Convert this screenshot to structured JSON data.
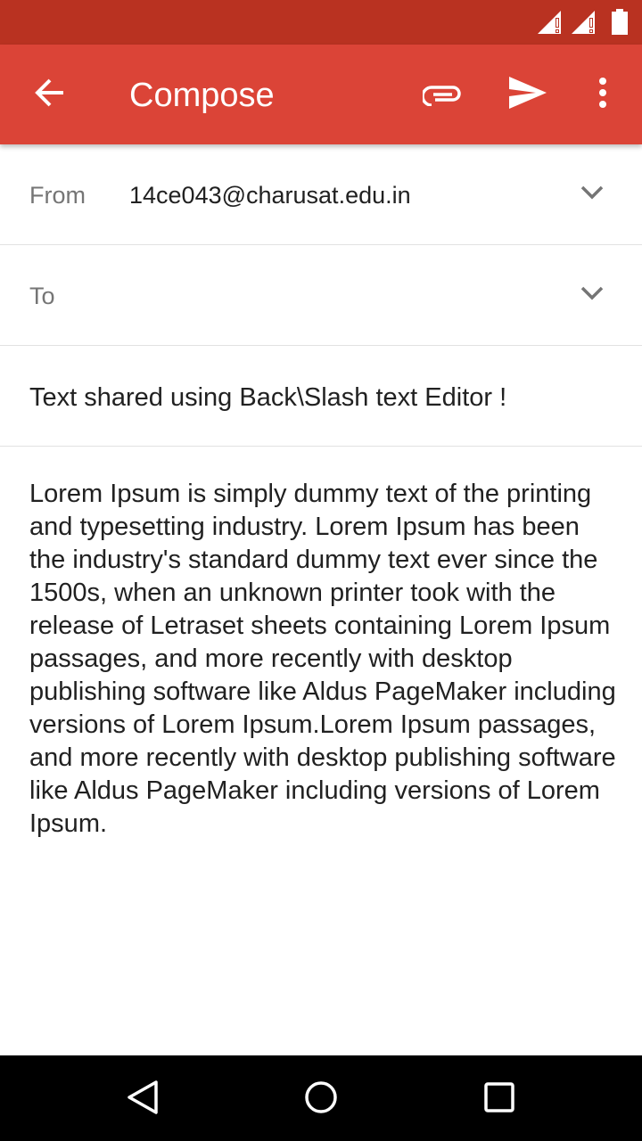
{
  "status_bar": {
    "icons": [
      "signal-no-data-icon",
      "signal-no-data-icon",
      "battery-icon"
    ]
  },
  "app_bar": {
    "title": "Compose",
    "actions": [
      "back-arrow-icon",
      "attach-icon",
      "send-icon",
      "more-vert-icon"
    ],
    "color": "#db4437",
    "status_color": "#b93221"
  },
  "compose": {
    "from_label": "From",
    "from_value": "14ce043@charusat.edu.in",
    "to_label": "To",
    "to_value": "",
    "subject": "Text shared using Back\\Slash text Editor !",
    "body": "Lorem Ipsum is simply dummy text of the printing and typesetting industry. Lorem Ipsum has been the industry's standard dummy text ever since the 1500s, when an unknown printer took with the release of Letraset sheets containing Lorem Ipsum passages, and more recently with desktop publishing software like Aldus PageMaker including versions of Lorem Ipsum.Lorem Ipsum passages, and more recently with desktop publishing software like Aldus PageMaker including versions of Lorem Ipsum."
  },
  "nav_bar": {
    "buttons": [
      "back-triangle-icon",
      "home-circle-icon",
      "recents-square-icon"
    ]
  }
}
